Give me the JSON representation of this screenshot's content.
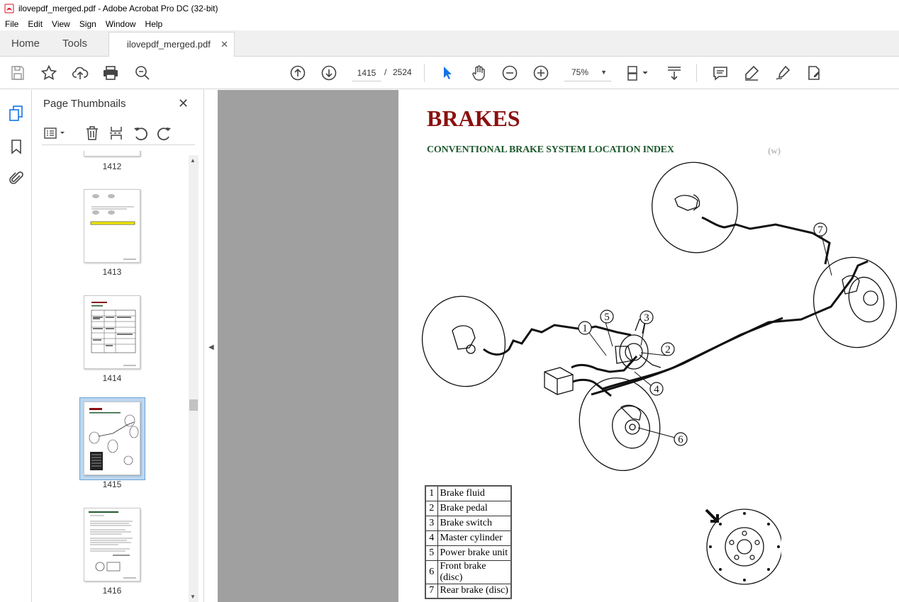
{
  "window": {
    "title": "ilovepdf_merged.pdf - Adobe Acrobat Pro DC (32-bit)"
  },
  "menu": [
    "File",
    "Edit",
    "View",
    "Sign",
    "Window",
    "Help"
  ],
  "tabs": {
    "home": "Home",
    "tools": "Tools",
    "document": "ilovepdf_merged.pdf"
  },
  "navigation": {
    "current_page": "1415",
    "separator": "/",
    "total_pages": "2524",
    "zoom": "75%"
  },
  "panel": {
    "title": "Page Thumbnails",
    "thumbnails": [
      {
        "label": "1412",
        "selected": false
      },
      {
        "label": "1413",
        "selected": false
      },
      {
        "label": "1414",
        "selected": false
      },
      {
        "label": "1415",
        "selected": true
      },
      {
        "label": "1416",
        "selected": false
      }
    ]
  },
  "document": {
    "title": "BRAKES",
    "subtitle": "CONVENTIONAL BRAKE SYSTEM LOCATION INDEX",
    "tag": "(w)",
    "callouts": [
      "1",
      "2",
      "3",
      "4",
      "5",
      "6",
      "7"
    ],
    "legend": [
      {
        "num": "1",
        "label": "Brake fluid"
      },
      {
        "num": "2",
        "label": "Brake pedal"
      },
      {
        "num": "3",
        "label": "Brake switch"
      },
      {
        "num": "4",
        "label": "Master cylinder"
      },
      {
        "num": "5",
        "label": "Power brake unit"
      },
      {
        "num": "6",
        "label": "Front brake (disc)"
      },
      {
        "num": "7",
        "label": "Rear brake (disc)"
      }
    ]
  },
  "colors": {
    "title_red": "#8b1010",
    "subtitle_green": "#1f5a2e",
    "selection_blue": "#bcd7ef",
    "viewer_gray": "#a0a0a0"
  }
}
